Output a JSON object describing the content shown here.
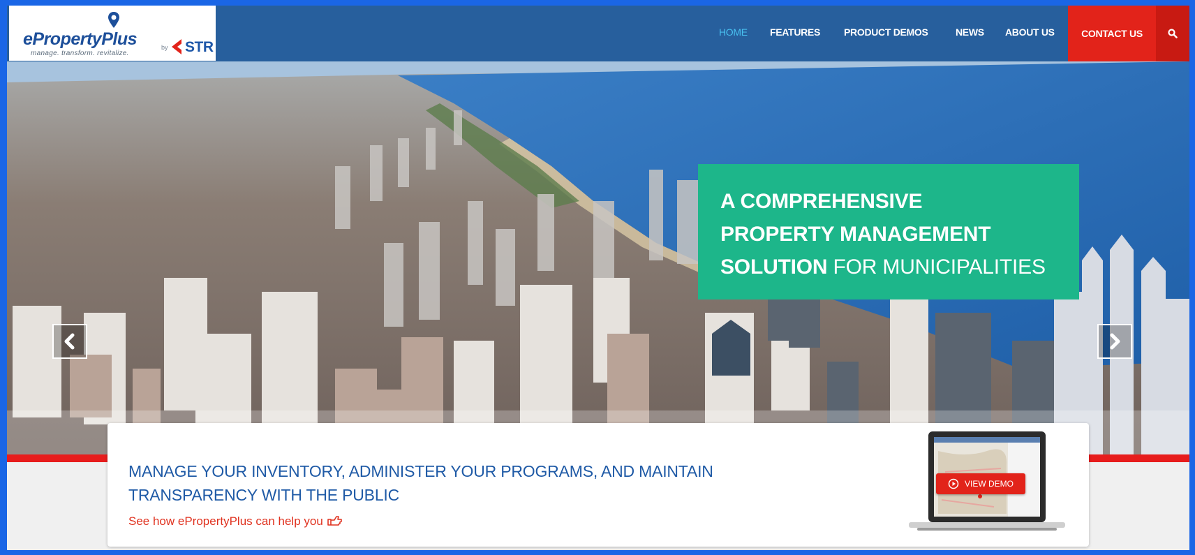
{
  "brand": {
    "name": "ePropertyPlus",
    "tagline": "manage. transform. revitalize.",
    "by": "by",
    "partner": "STR"
  },
  "nav": {
    "items": [
      {
        "label": "HOME",
        "active": true
      },
      {
        "label": "FEATURES",
        "active": false
      },
      {
        "label": "PRODUCT DEMOS",
        "active": false
      },
      {
        "label": "NEWS",
        "active": false
      },
      {
        "label": "ABOUT US",
        "active": false
      }
    ],
    "contact_label": "CONTACT US",
    "search_icon": "search-icon"
  },
  "hero": {
    "headline_line1": "A COMPREHENSIVE",
    "headline_line2": "PROPERTY MANAGEMENT",
    "headline_line3_bold": "SOLUTION",
    "headline_line3_rest": " FOR MUNICIPALITIES",
    "prev_icon": "chevron-left-icon",
    "next_icon": "chevron-right-icon"
  },
  "feature": {
    "title_line1": "MANAGE YOUR INVENTORY, ADMINISTER YOUR PROGRAMS, AND MAINTAIN",
    "title_line2": "TRANSPARENCY WITH THE PUBLIC",
    "link_text": "See how ePropertyPlus can help you",
    "link_icon": "hand-pointing-icon",
    "demo_label": "VIEW DEMO",
    "demo_icon": "play-icon"
  },
  "colors": {
    "header_bg": "#275f9d",
    "active_nav": "#49c1f1",
    "contact_bg": "#e2231a",
    "headline_bg": "#1db68a",
    "title_blue": "#1f5aa6",
    "link_red": "#e0321f",
    "stripe_red": "#e71c1c"
  }
}
